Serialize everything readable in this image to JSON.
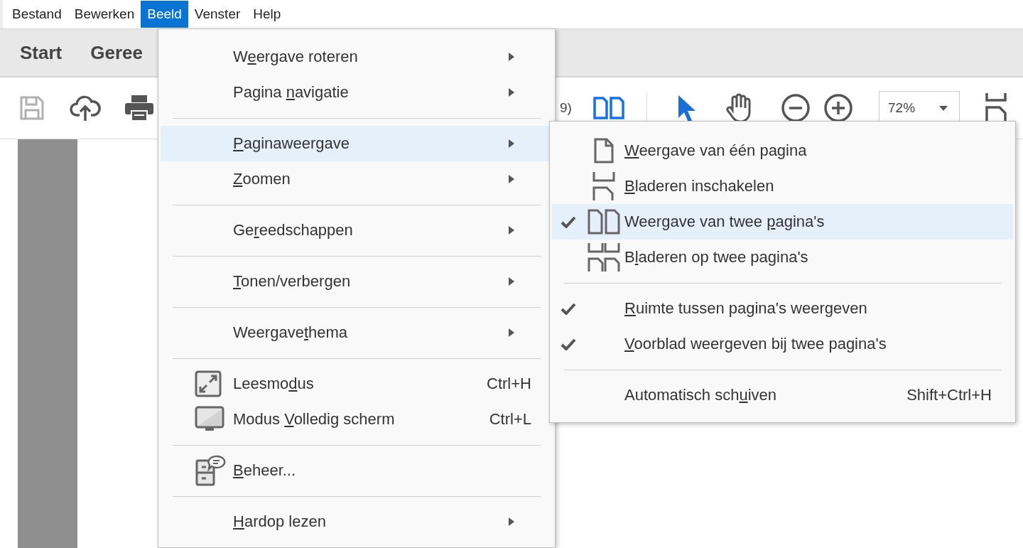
{
  "menu_bar": [
    {
      "label": "Bestand",
      "selected": false
    },
    {
      "label": "Bewerken",
      "selected": false
    },
    {
      "label": "Beeld",
      "selected": true
    },
    {
      "label": "Venster",
      "selected": false
    },
    {
      "label": "Help",
      "selected": false
    }
  ],
  "tabs": [
    {
      "label": "Start"
    },
    {
      "label": "Geree"
    }
  ],
  "toolbar": {
    "save": {
      "disabled": true
    },
    "page_text": "9)",
    "two_page_view": {
      "selected": true
    },
    "tools": [
      {
        "selected": true
      },
      {
        "selected": false
      }
    ],
    "zoom": {
      "value": "72%"
    }
  },
  "menu": {
    "items": [
      {
        "kind": "submenu",
        "label": {
          "before": "W",
          "key": "e",
          "after": "ergave roteren"
        },
        "selected": false
      },
      {
        "kind": "submenu",
        "label": {
          "before": "Pagina ",
          "key": "n",
          "after": "avigatie"
        },
        "selected": false
      },
      {
        "kind": "separator"
      },
      {
        "kind": "submenu",
        "label": {
          "key": "P",
          "after": "aginaweergave"
        },
        "selected": true
      },
      {
        "kind": "submenu",
        "label": {
          "key": "Z",
          "after": "oomen"
        },
        "selected": false
      },
      {
        "kind": "separator"
      },
      {
        "kind": "submenu",
        "label": {
          "before": "Ge",
          "key": "r",
          "after": "eedschappen"
        },
        "selected": false
      },
      {
        "kind": "separator"
      },
      {
        "kind": "submenu",
        "label": {
          "key": "T",
          "after": "onen/verbergen"
        },
        "selected": false
      },
      {
        "kind": "separator"
      },
      {
        "kind": "submenu",
        "label": {
          "before": "Weergave",
          "key": "t",
          "after": "hema"
        },
        "selected": false
      },
      {
        "kind": "separator"
      },
      {
        "kind": "command",
        "label": {
          "before": "Leesmo",
          "key": "d",
          "after": "us"
        },
        "shortcut": "Ctrl+H",
        "selected": false
      },
      {
        "kind": "command",
        "label": {
          "before": "Modus ",
          "key": "V",
          "after": "olledig scherm"
        },
        "shortcut": "Ctrl+L",
        "selected": false
      },
      {
        "kind": "separator"
      },
      {
        "kind": "command",
        "label": {
          "key": "B",
          "after": "eheer..."
        },
        "selected": false
      },
      {
        "kind": "separator"
      },
      {
        "kind": "submenu",
        "label": {
          "key": "H",
          "after": "ardop lezen"
        },
        "selected": false
      }
    ]
  },
  "submenu": {
    "items": [
      {
        "kind": "option",
        "checked": false,
        "selected": false,
        "label": {
          "key": "W",
          "after": "eergave van één pagina"
        }
      },
      {
        "kind": "option",
        "checked": false,
        "selected": false,
        "label": {
          "key": "B",
          "after": "laderen inschakelen"
        }
      },
      {
        "kind": "option",
        "checked": true,
        "selected": true,
        "label": {
          "before": "Weergave van twee ",
          "key": "p",
          "after": "agina's"
        }
      },
      {
        "kind": "option",
        "checked": false,
        "selected": false,
        "label": {
          "before": "B",
          "key": "l",
          "after": "aderen op twee pagina's"
        }
      },
      {
        "kind": "separator"
      },
      {
        "kind": "option",
        "checked": true,
        "selected": false,
        "label": {
          "key": "R",
          "after": "uimte tussen pagina's weergeven"
        }
      },
      {
        "kind": "option",
        "checked": true,
        "selected": false,
        "label": {
          "key": "V",
          "after": "oorblad weergeven bij twee pagina's"
        }
      },
      {
        "kind": "separator"
      },
      {
        "kind": "option",
        "checked": false,
        "selected": false,
        "label": {
          "before": "Automatisch sch",
          "key": "u",
          "after": "iven"
        },
        "shortcut": "Shift+Ctrl+H"
      }
    ]
  }
}
